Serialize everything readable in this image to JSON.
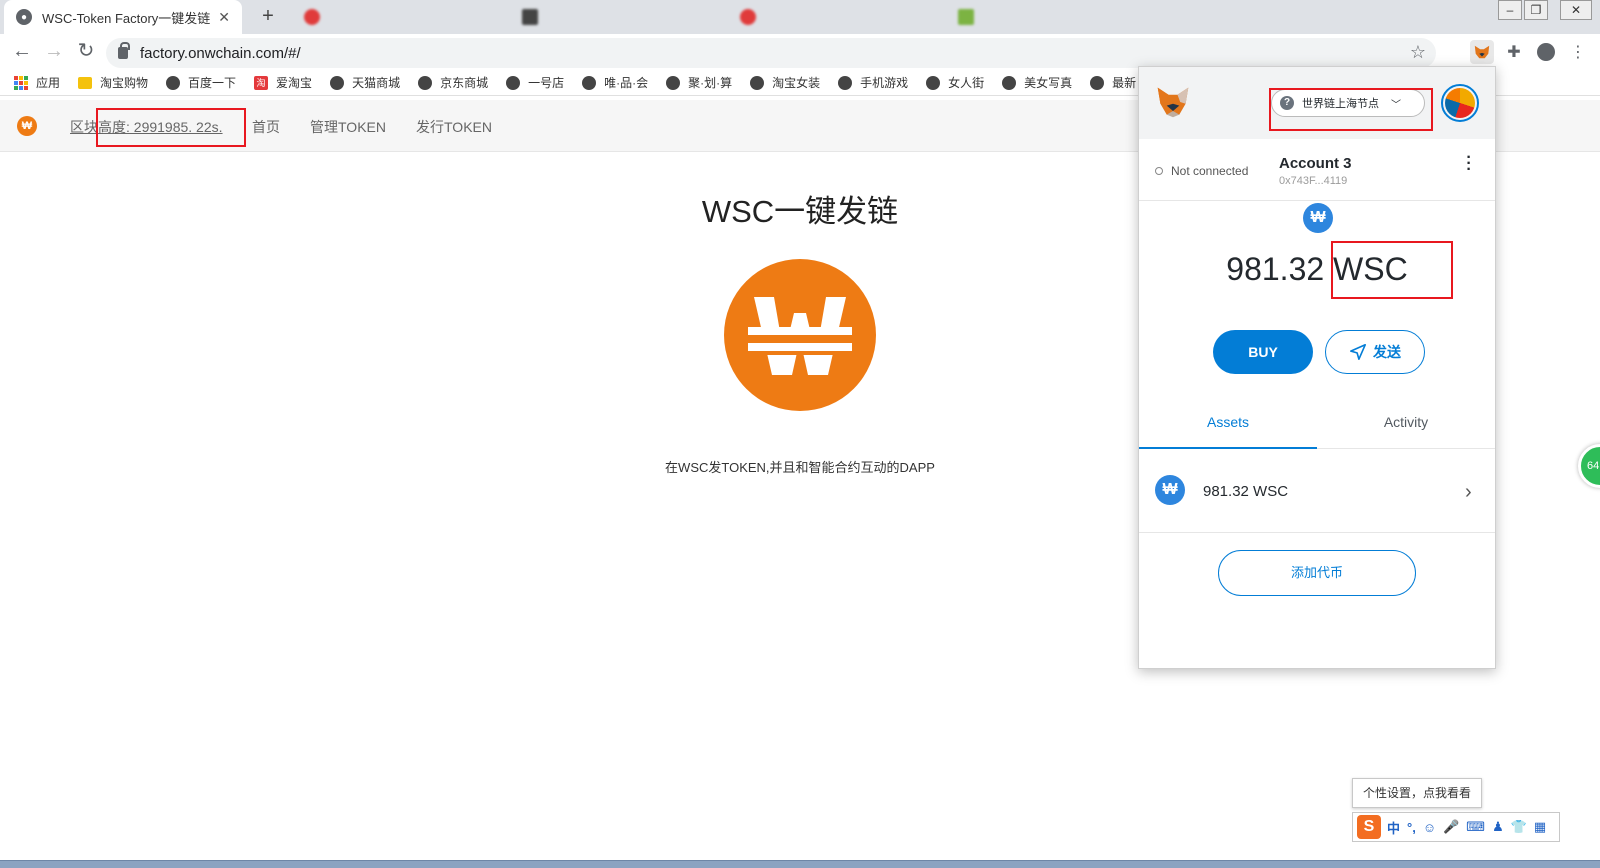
{
  "browser": {
    "active_tab_title": "WSC-Token Factory一键发链",
    "address": "factory.onwchain.com/#/"
  },
  "bookmarks": [
    "应用",
    "淘宝购物",
    "百度一下",
    "爱淘宝",
    "天猫商城",
    "京东商城",
    "一号店",
    "唯·品·会",
    "聚·划·算",
    "淘宝女装",
    "手机游戏",
    "女人街",
    "美女写真",
    "最新"
  ],
  "site": {
    "block_height": "区块高度: 2991985. 22s.",
    "nav": [
      "首页",
      "管理TOKEN",
      "发行TOKEN"
    ],
    "title": "WSC一键发链",
    "description": "在WSC发TOKEN,并且和智能合约互动的DAPP"
  },
  "metamask": {
    "network": "世界链上海节点",
    "connection": "Not connected",
    "account_name": "Account 3",
    "account_address": "0x743F...4119",
    "balance_amount": "981.32",
    "balance_symbol": "WSC",
    "buy_label": "BUY",
    "send_label": "发送",
    "tabs": [
      "Assets",
      "Activity"
    ],
    "asset_label": "981.32 WSC",
    "add_token_label": "添加代币"
  },
  "floating_badge": "64",
  "ime": {
    "tip": "个性设置，点我看看",
    "mode": "中"
  },
  "colors": {
    "brand_orange": "#ee7b14",
    "metamask_blue": "#037dd6",
    "highlight_red": "#e8181f"
  }
}
